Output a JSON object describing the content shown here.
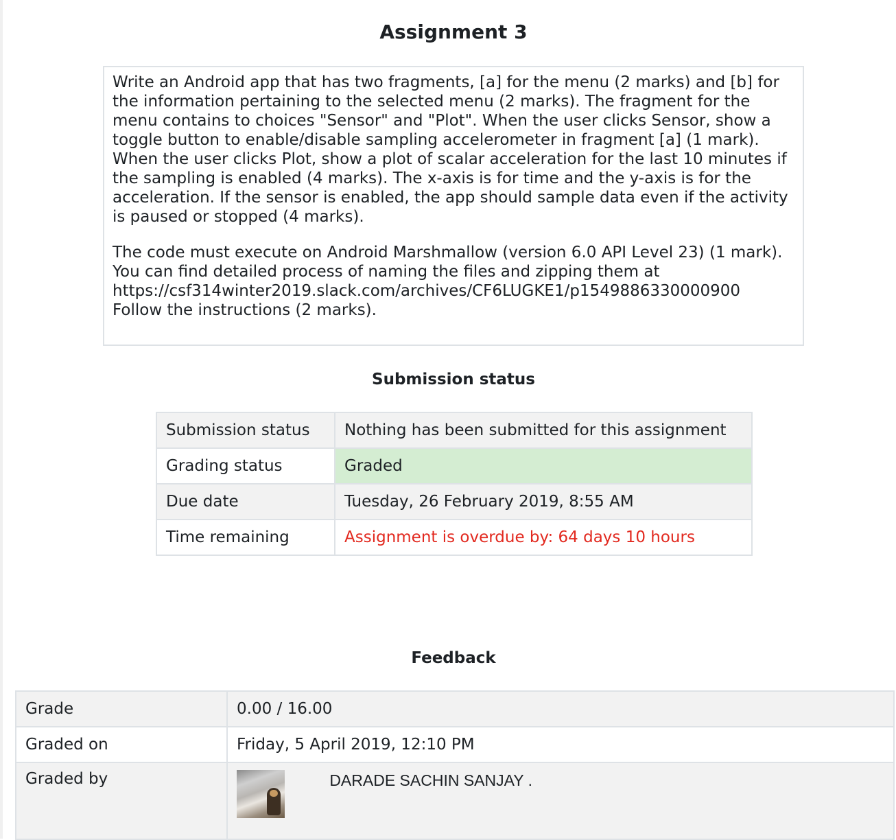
{
  "page": {
    "title": "Assignment 3"
  },
  "intro": {
    "paragraph1": "Write an Android app that has two fragments, [a] for the menu (2 marks) and [b] for the information pertaining to the selected menu (2 marks). The fragment for the menu contains to choices \"Sensor\" and \"Plot\". When the user clicks Sensor, show a toggle button to enable/disable sampling accelerometer in fragment [a] (1 mark). When the user clicks Plot, show a plot of scalar acceleration for the last 10 minutes if the sampling is enabled (4 marks). The x-axis is for time and the y-axis is for the acceleration. If the sensor is enabled, the app should sample data even if the activity is paused or stopped (4 marks).",
    "paragraph2_line1": "The code must execute on Android Marshmallow (version 6.0 API Level 23) (1 mark). You can find detailed process of naming the files and zipping them at",
    "paragraph2_link": "https://csf314winter2019.slack.com/archives/CF6LUGKE1/p1549886330000900",
    "paragraph2_line3": "Follow the instructions (2 marks)."
  },
  "submission": {
    "heading": "Submission status",
    "rows": [
      {
        "label": "Submission status",
        "value": "Nothing has been submitted for this assignment"
      },
      {
        "label": "Grading status",
        "value": "Graded"
      },
      {
        "label": "Due date",
        "value": "Tuesday, 26 February 2019, 8:55 AM"
      },
      {
        "label": "Time remaining",
        "value": "Assignment is overdue by: 64 days 10 hours"
      }
    ],
    "colors": {
      "graded_bg": "#d4edd2",
      "overdue_text": "#e2291f"
    }
  },
  "feedback": {
    "heading": "Feedback",
    "rows": [
      {
        "label": "Grade",
        "value": "0.00 / 16.00"
      },
      {
        "label": "Graded on",
        "value": "Friday, 5 April 2019, 12:10 PM"
      },
      {
        "label": "Graded by",
        "value": "DARADE SACHIN SANJAY ."
      }
    ],
    "grader_avatar_icon": "user-avatar-photo"
  }
}
